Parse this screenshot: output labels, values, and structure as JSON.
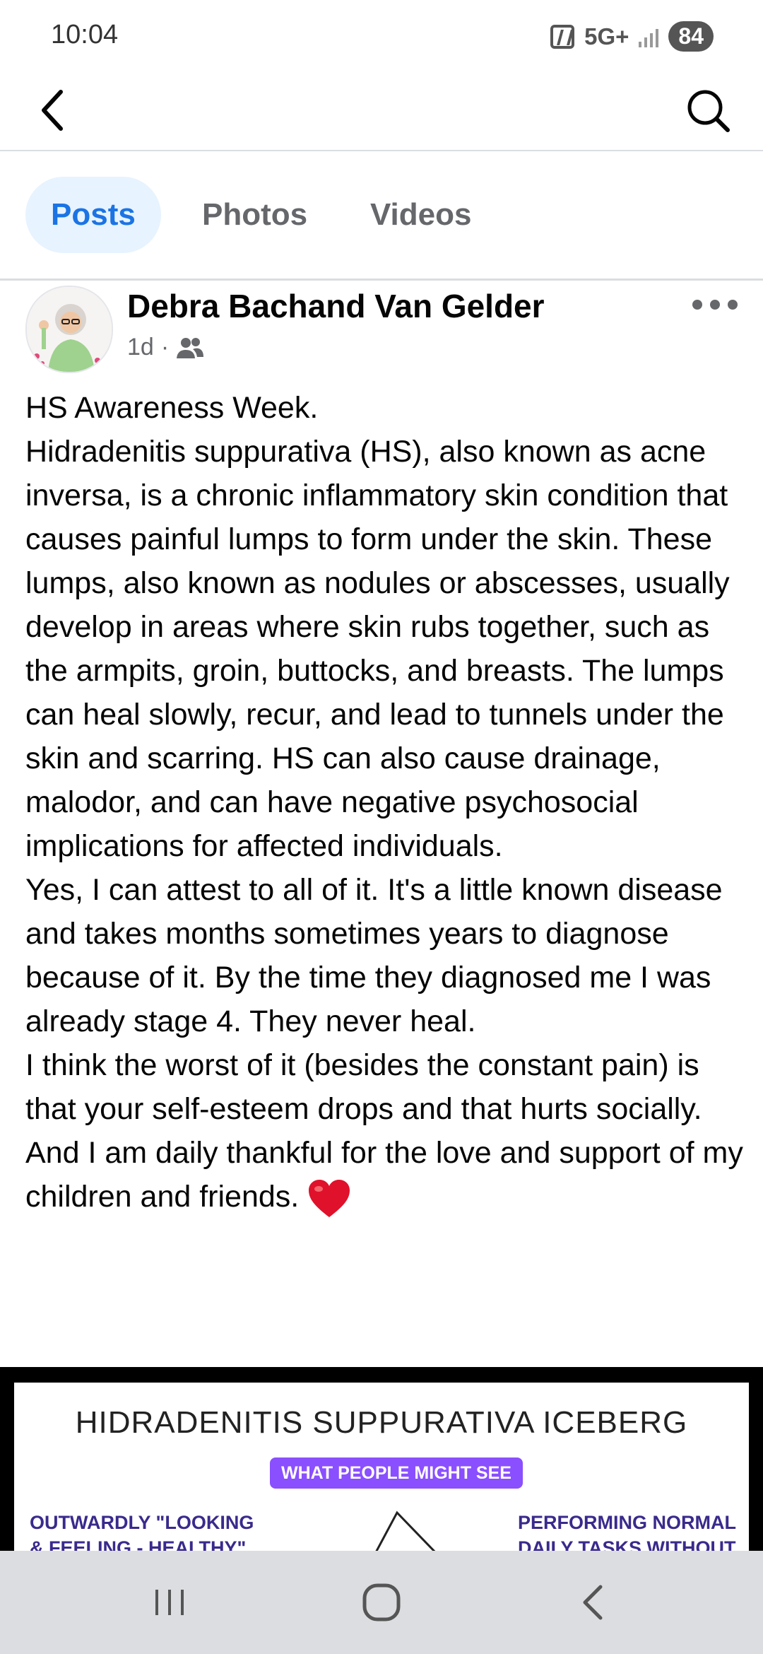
{
  "status_bar": {
    "time": "10:04",
    "network": "5G+",
    "battery": "84",
    "icons": [
      "nfc-icon",
      "signal-icon"
    ]
  },
  "top_bar": {
    "icons": [
      "back-arrow-icon",
      "search-icon"
    ]
  },
  "tabs": [
    {
      "label": "Posts",
      "active": true
    },
    {
      "label": "Photos",
      "active": false
    },
    {
      "label": "Videos",
      "active": false
    }
  ],
  "post": {
    "author": "Debra Bachand Van Gelder",
    "time_ago": "1d",
    "separator": "·",
    "audience_icon": "friends-icon",
    "paragraphs": [
      "HS Awareness Week.",
      "Hidradenitis suppurativa (HS), also known as acne inversa, is a chronic inflammatory skin condition that causes painful lumps to form under the skin. These lumps, also known as nodules or abscesses, usually develop in areas where skin rubs together, such as the armpits, groin, buttocks, and breasts. The lumps can heal slowly, recur, and lead to tunnels under the skin and scarring. HS can also cause drainage, malodor, and can have negative psychosocial implications for affected individuals.",
      "Yes, I can attest to all of it. It's a little known disease and takes months sometimes years to diagnose because of it.  By the time they diagnosed me I was already stage 4. They never heal.",
      "I think the worst of it (besides the constant pain) is that your self-esteem drops and that hurts socially.",
      "And I am daily thankful for the love and support of my children and friends."
    ],
    "emoji": "heart-emoji",
    "image": {
      "title": "HIDRADENITIS SUPPURATIVA ICEBERG",
      "pill": "WHAT PEOPLE MIGHT SEE",
      "left_lines": [
        "OUTWARDLY \"LOOKING",
        "& FEELING - HEALTHY\""
      ],
      "right_lines": [
        "PERFORMING NORMAL",
        "DAILY TASKS WITHOUT"
      ],
      "accent": "#8a4fff"
    }
  },
  "nav_bar": {
    "icons": [
      "recent-apps-icon",
      "home-icon",
      "back-icon"
    ]
  },
  "colors": {
    "accent": "#1b74e4",
    "tab_active_bg": "#e7f3ff",
    "muted": "#65676b",
    "heart": "#e0112b"
  }
}
